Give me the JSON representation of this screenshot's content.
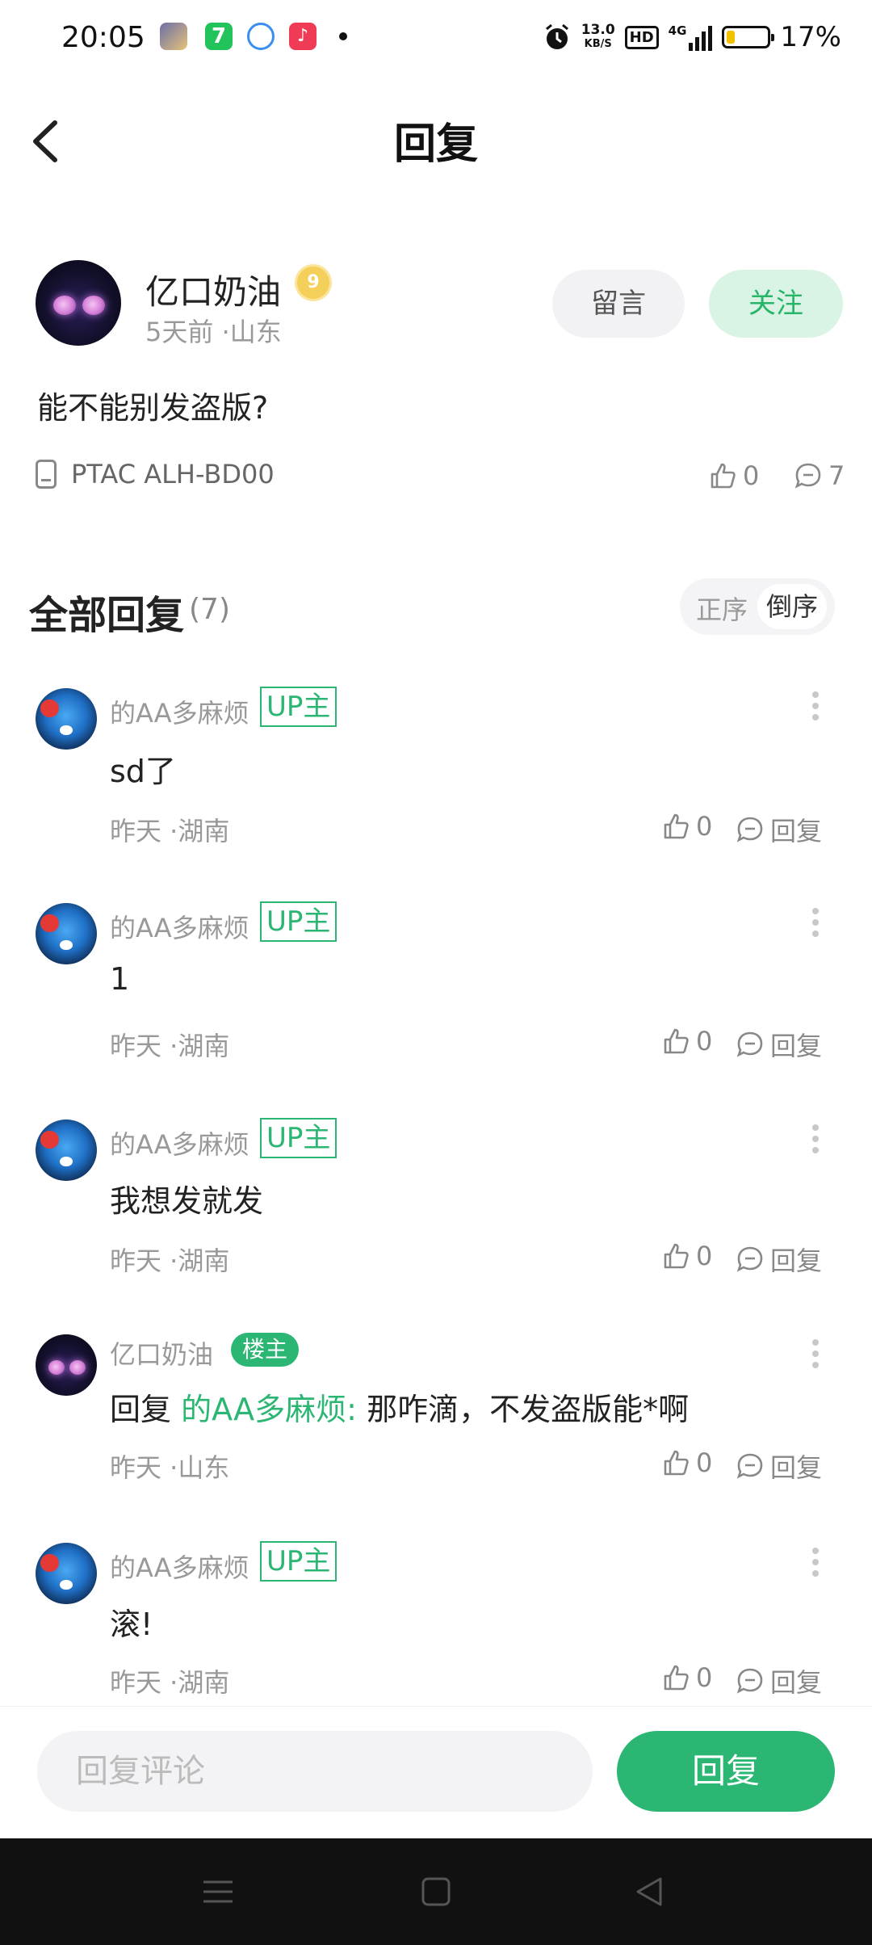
{
  "status_bar": {
    "time": "20:05",
    "network_speed_top": "13.0",
    "network_speed_unit": "KB/S",
    "hd_label": "HD",
    "network_type": "4G",
    "battery_percent": "17%",
    "battery_level": 0.17,
    "battery_color": "#f2c200"
  },
  "header": {
    "title": "回复",
    "back_icon": "chevron-left-icon"
  },
  "post": {
    "author": "亿口奶油",
    "level": "9",
    "meta": "5天前 ·山东",
    "message_button": "留言",
    "follow_button": "关注",
    "content": "能不能别发盗版?",
    "device": "PTAC ALH-BD00",
    "likes": "0",
    "comments": "7"
  },
  "replies_section": {
    "title": "全部回复",
    "count": "(7)",
    "sort_asc": "正序",
    "sort_desc": "倒序"
  },
  "replies": [
    {
      "name": "的AA多麻烦",
      "tag": "UP主",
      "text": "sd了",
      "meta": "昨天 ·湖南",
      "likes": "0",
      "reply_label": "回复"
    },
    {
      "name": "的AA多麻烦",
      "tag": "UP主",
      "text": "1",
      "meta": "昨天 ·湖南",
      "likes": "0",
      "reply_label": "回复"
    },
    {
      "name": "的AA多麻烦",
      "tag": "UP主",
      "text": "我想发就发",
      "meta": "昨天 ·湖南",
      "likes": "0",
      "reply_label": "回复"
    },
    {
      "name": "亿口奶油",
      "tag": "楼主",
      "reply_prefix": "回复",
      "reply_target": "的AA多麻烦:",
      "text": "那咋滴，不发盗版能*啊",
      "meta": "昨天 ·山东",
      "likes": "0",
      "reply_label": "回复"
    },
    {
      "name": "的AA多麻烦",
      "tag": "UP主",
      "text": "滚!",
      "meta": "昨天 ·湖南",
      "likes": "0",
      "reply_label": "回复"
    }
  ],
  "bottom_bar": {
    "placeholder": "回复评论",
    "submit": "回复"
  },
  "colors": {
    "accent": "#2bb673",
    "follow_bg": "#d9f3e4"
  }
}
